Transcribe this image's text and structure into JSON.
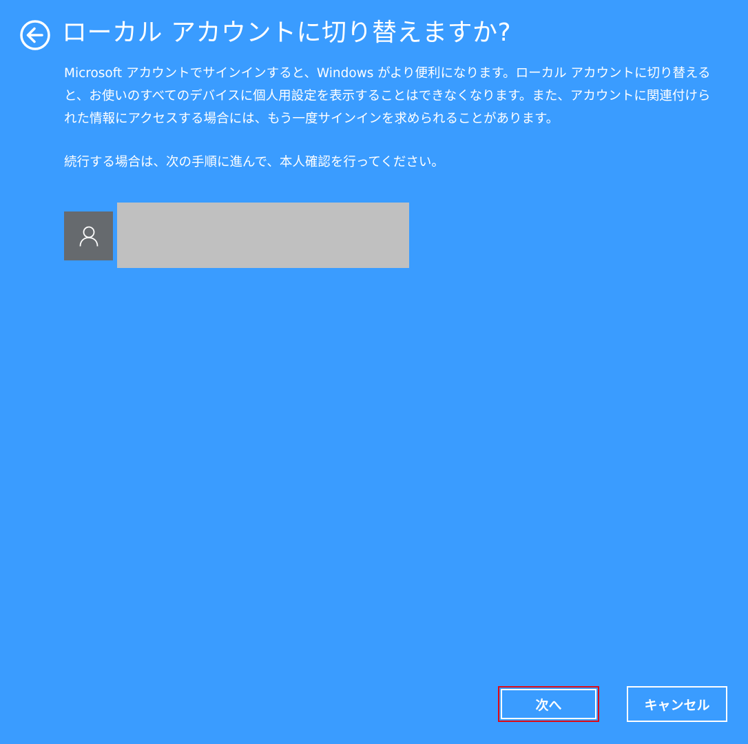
{
  "header": {
    "back_icon": "arrow-left-circle-icon",
    "title": "ローカル アカウントに切り替えますか?"
  },
  "content": {
    "description": "Microsoft アカウントでサインインすると、Windows がより便利になります。ローカル アカウントに切り替えると、お使いのすべてのデバイスに個人用設定を表示することはできなくなります。また、アカウントに関連付けられた情報にアクセスする場合には、もう一度サインインを求められることがあります。",
    "instruction": "続行する場合は、次の手順に進んで、本人確認を行ってください。"
  },
  "account": {
    "avatar_icon": "person-icon"
  },
  "footer": {
    "next_label": "次へ",
    "cancel_label": "キャンセル"
  },
  "colors": {
    "background": "#3a9cff",
    "highlight_border": "#e00a14",
    "avatar_bg": "#666a6e",
    "redacted_box": "#c0c0c0"
  }
}
